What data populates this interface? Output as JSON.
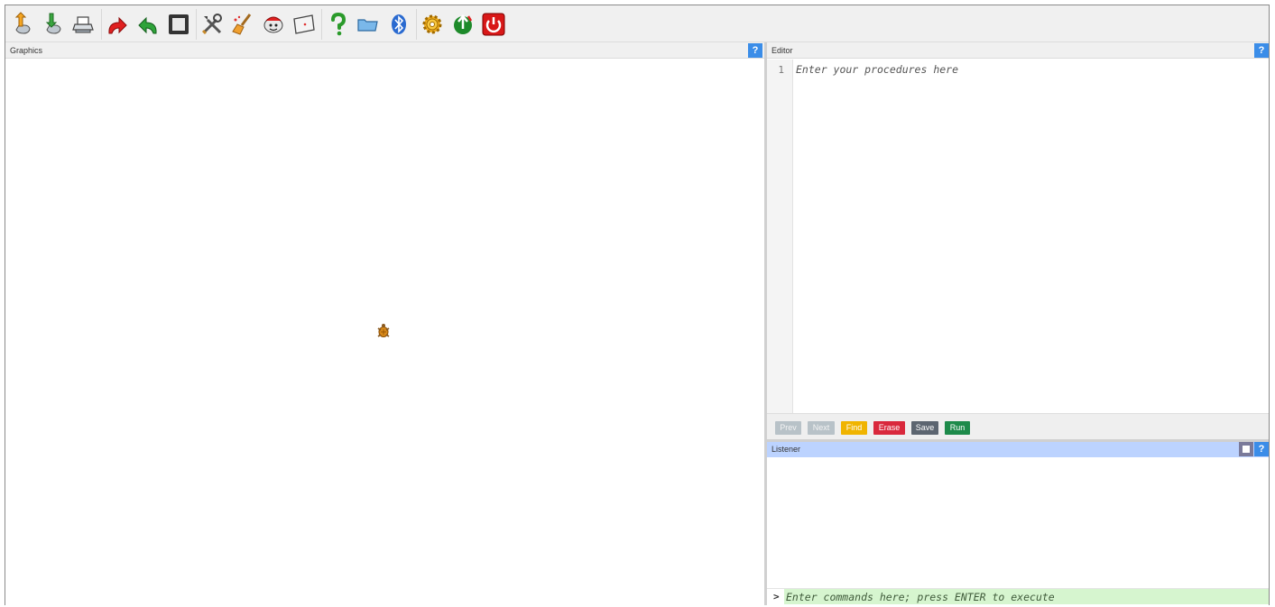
{
  "toolbar": {
    "items": [
      {
        "name": "load-icon",
        "title": "Load"
      },
      {
        "name": "save-icon",
        "title": "Save"
      },
      {
        "name": "print-icon",
        "title": "Print"
      },
      {
        "name": "redo-icon",
        "title": "Redo"
      },
      {
        "name": "undo-icon",
        "title": "Undo"
      },
      {
        "name": "stop-icon",
        "title": "Stop"
      },
      {
        "name": "tools-icon",
        "title": "Tools"
      },
      {
        "name": "clean-icon",
        "title": "Clean"
      },
      {
        "name": "turtle-icon",
        "title": "Turtle"
      },
      {
        "name": "window-icon",
        "title": "Window"
      },
      {
        "name": "help-icon",
        "title": "Help"
      },
      {
        "name": "folder-icon",
        "title": "Folder"
      },
      {
        "name": "bluetooth-icon",
        "title": "Bluetooth"
      },
      {
        "name": "settings-icon",
        "title": "Settings"
      },
      {
        "name": "update-icon",
        "title": "Update"
      },
      {
        "name": "power-icon",
        "title": "Power"
      }
    ]
  },
  "graphics": {
    "title": "Graphics",
    "help": "?"
  },
  "editor": {
    "title": "Editor",
    "help": "?",
    "line_number": "1",
    "placeholder": "Enter your procedures here",
    "buttons": {
      "prev": "Prev",
      "next": "Next",
      "find": "Find",
      "erase": "Erase",
      "save": "Save",
      "run": "Run"
    }
  },
  "listener": {
    "title": "Listener",
    "help": "?",
    "prompt": ">",
    "placeholder": "Enter commands here; press ENTER to execute"
  },
  "colors": {
    "help_button": "#3b8de8",
    "listener_header": "#bcd3ff",
    "listener_input": "#d6f5cf",
    "find": "#f0b400",
    "erase": "#d9283c",
    "save": "#5c6570",
    "run": "#1d8a4a"
  }
}
